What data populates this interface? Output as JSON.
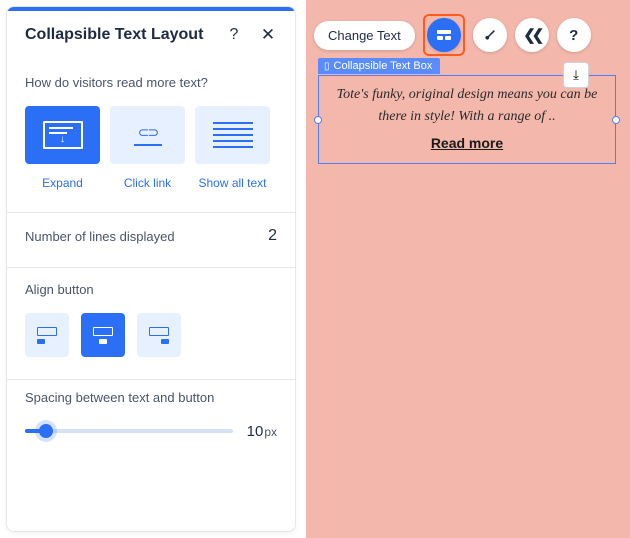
{
  "panel": {
    "title": "Collapsible Text Layout",
    "help_symbol": "?",
    "close_symbol": "✕",
    "read_mode": {
      "question": "How do visitors read more text?",
      "options": [
        {
          "key": "expand",
          "label": "Expand",
          "selected": true
        },
        {
          "key": "clicklink",
          "label": "Click link",
          "selected": false
        },
        {
          "key": "showall",
          "label": "Show all text",
          "selected": false
        }
      ]
    },
    "lines_displayed": {
      "label": "Number of lines displayed",
      "value": "2"
    },
    "align_button": {
      "label": "Align button",
      "options": [
        "left",
        "center",
        "right"
      ],
      "selected": "center"
    },
    "spacing": {
      "label": "Spacing between text and button",
      "value": "10",
      "unit": "px",
      "percent": 10
    }
  },
  "toolbar": {
    "change_text": "Change Text",
    "layout_active": true
  },
  "element": {
    "tag_label": "Collapsible Text Box",
    "preview_text": "Tote's funky, original design means you can be there in style! With a range of ..",
    "read_more": "Read more"
  }
}
